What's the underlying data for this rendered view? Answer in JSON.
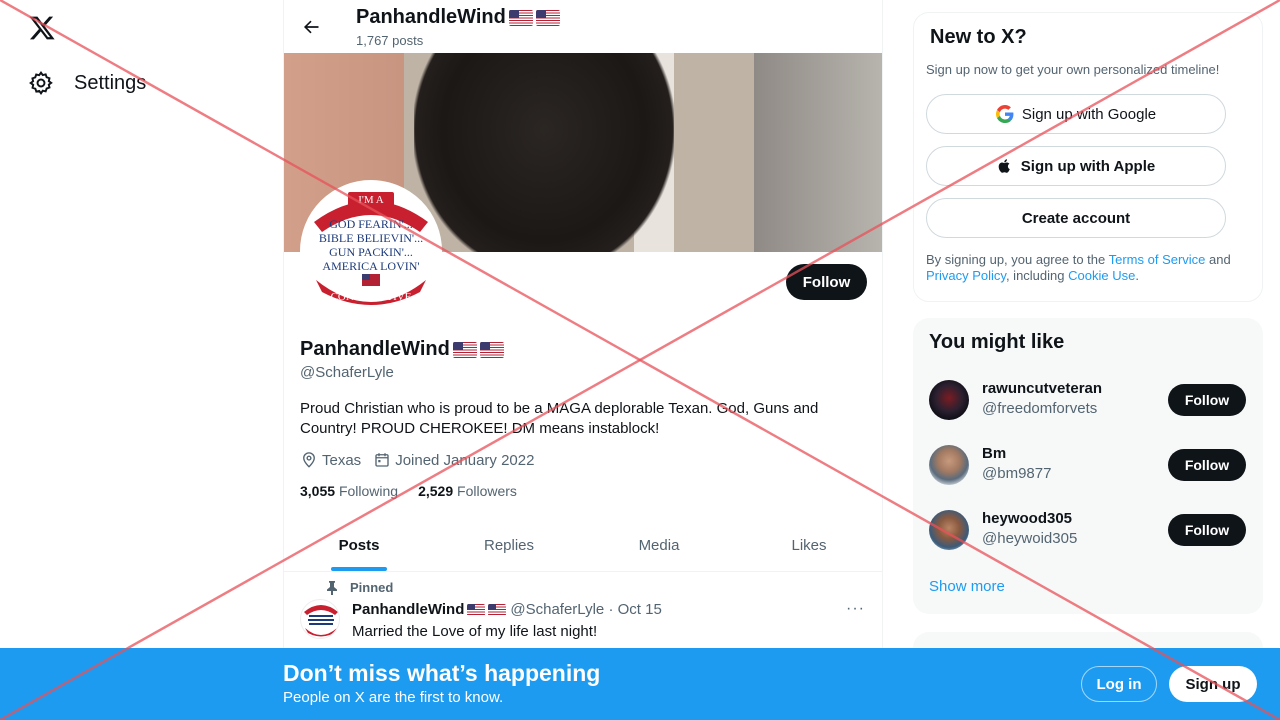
{
  "nav": {
    "settings_label": "Settings"
  },
  "header": {
    "title": "PanhandleWind",
    "posts_count": "1,767 posts"
  },
  "profile": {
    "follow_label": "Follow",
    "name": "PanhandleWind",
    "handle": "@SchaferLyle",
    "bio": "Proud Christian who is proud to be a MAGA deplorable Texan. God, Guns and Country! PROUD CHEROKEE! DM means instablock!",
    "location": "Texas",
    "joined": "Joined January 2022",
    "following_count": "3,055",
    "following_label": "Following",
    "followers_count": "2,529",
    "followers_label": "Followers",
    "avatar_lines": [
      "I'M A",
      "GOD FEARIN'...",
      "BIBLE BELIEVIN'...",
      "GUN PACKIN'...",
      "AMERICA LOVIN'",
      "CONSERVATIVE"
    ]
  },
  "tabs": [
    "Posts",
    "Replies",
    "Media",
    "Likes"
  ],
  "pinned_tweet": {
    "pinned_label": "Pinned",
    "name": "PanhandleWind",
    "handle": "@SchaferLyle",
    "date": "· Oct 15",
    "text": "Married the Love of my life last night!",
    "more": "···"
  },
  "new_to_x": {
    "title": "New to X?",
    "subtitle": "Sign up now to get your own personalized timeline!",
    "google": "Sign up with Google",
    "apple": "Sign up with Apple",
    "create": "Create account",
    "legal_pre": "By signing up, you agree to the ",
    "terms": "Terms of Service",
    "legal_and": " and ",
    "privacy": "Privacy Policy",
    "legal_mid": ", including ",
    "cookie": "Cookie Use",
    "legal_end": "."
  },
  "you_might_like": {
    "title": "You might like",
    "users": [
      {
        "name": "rawuncutveteran",
        "handle": "@freedomforvets",
        "follow": "Follow"
      },
      {
        "name": "Bm",
        "handle": "@bm9877",
        "follow": "Follow"
      },
      {
        "name": "heywood305",
        "handle": "@heywoid305",
        "follow": "Follow"
      }
    ],
    "show_more": "Show more"
  },
  "bottom_bar": {
    "headline": "Don’t miss what’s happening",
    "subline": "People on X are the first to know.",
    "login": "Log in",
    "signup": "Sign up"
  },
  "colors": {
    "accent": "#1d9bf0",
    "text": "#0f1419",
    "muted": "#536471",
    "overlay_x": "#e8515a"
  }
}
